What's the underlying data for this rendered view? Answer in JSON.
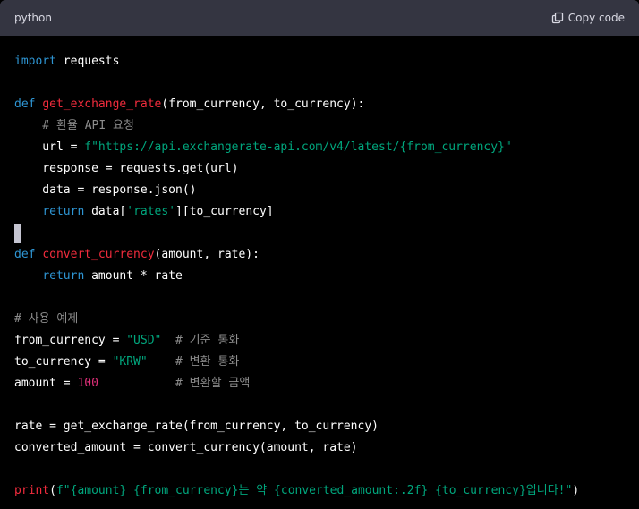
{
  "header": {
    "language": "python",
    "copy_label": "Copy code",
    "copy_icon": "clipboard-icon"
  },
  "colors": {
    "keyword": "#2e95d3",
    "function": "#f22c3d",
    "string": "#00a67d",
    "number": "#df3079",
    "comment": "#8c8c8c",
    "text": "#ffffff",
    "header_bg": "#343541",
    "body_bg": "#000000"
  },
  "code_lines": [
    [
      {
        "t": "import",
        "c": "keyword"
      },
      {
        "t": " requests",
        "c": "text"
      }
    ],
    [],
    [
      {
        "t": "def",
        "c": "keyword"
      },
      {
        "t": " ",
        "c": "text"
      },
      {
        "t": "get_exchange_rate",
        "c": "function"
      },
      {
        "t": "(from_currency, to_currency):",
        "c": "text"
      }
    ],
    [
      {
        "t": "    # 환율 API 요청",
        "c": "comment"
      }
    ],
    [
      {
        "t": "    url = ",
        "c": "text"
      },
      {
        "t": "f\"https://api.exchangerate-api.com/v4/latest/{from_currency}\"",
        "c": "string"
      }
    ],
    [
      {
        "t": "    response = requests.get(url)",
        "c": "text"
      }
    ],
    [
      {
        "t": "    data = response.json()",
        "c": "text"
      }
    ],
    [
      {
        "t": "    ",
        "c": "text"
      },
      {
        "t": "return",
        "c": "keyword"
      },
      {
        "t": " data[",
        "c": "text"
      },
      {
        "t": "'rates'",
        "c": "string"
      },
      {
        "t": "][to_currency]",
        "c": "text"
      }
    ],
    [
      {
        "t": "",
        "c": "cursor"
      }
    ],
    [
      {
        "t": "def",
        "c": "keyword"
      },
      {
        "t": " ",
        "c": "text"
      },
      {
        "t": "convert_currency",
        "c": "function"
      },
      {
        "t": "(amount, rate):",
        "c": "text"
      }
    ],
    [
      {
        "t": "    ",
        "c": "text"
      },
      {
        "t": "return",
        "c": "keyword"
      },
      {
        "t": " amount * rate",
        "c": "text"
      }
    ],
    [],
    [
      {
        "t": "# 사용 예제",
        "c": "comment"
      }
    ],
    [
      {
        "t": "from_currency = ",
        "c": "text"
      },
      {
        "t": "\"USD\"",
        "c": "string"
      },
      {
        "t": "  ",
        "c": "text"
      },
      {
        "t": "# 기준 통화",
        "c": "comment"
      }
    ],
    [
      {
        "t": "to_currency = ",
        "c": "text"
      },
      {
        "t": "\"KRW\"",
        "c": "string"
      },
      {
        "t": "    ",
        "c": "text"
      },
      {
        "t": "# 변환 통화",
        "c": "comment"
      }
    ],
    [
      {
        "t": "amount = ",
        "c": "text"
      },
      {
        "t": "100",
        "c": "number"
      },
      {
        "t": "           ",
        "c": "text"
      },
      {
        "t": "# 변환할 금액",
        "c": "comment"
      }
    ],
    [],
    [
      {
        "t": "rate = get_exchange_rate(from_currency, to_currency)",
        "c": "text"
      }
    ],
    [
      {
        "t": "converted_amount = convert_currency(amount, rate)",
        "c": "text"
      }
    ],
    [],
    [
      {
        "t": "print",
        "c": "function"
      },
      {
        "t": "(",
        "c": "text"
      },
      {
        "t": "f\"{amount} {from_currency}는 약 {converted_amount:.2f} {to_currency}입니다!\"",
        "c": "string"
      },
      {
        "t": ")",
        "c": "text"
      }
    ]
  ]
}
